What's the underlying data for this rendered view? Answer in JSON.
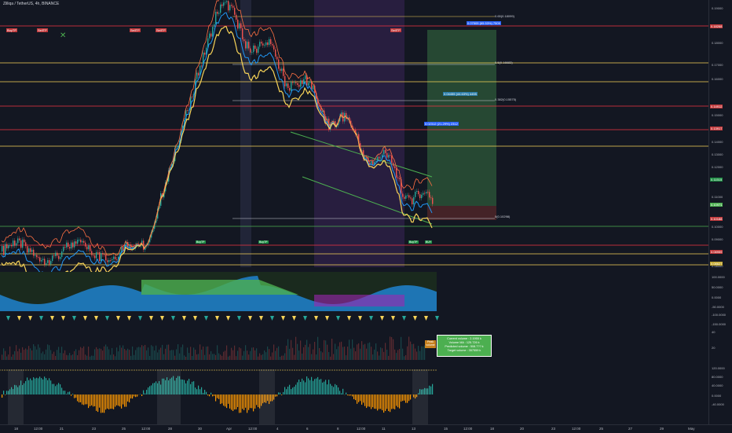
{
  "header": {
    "title": "Zilliqa / TetherUS, 4h, BINANCE"
  },
  "price_axis": {
    "labels": [
      "0.19000",
      "0.18000",
      "0.17000",
      "0.16000",
      "0.15000",
      "0.14000",
      "0.13000",
      "0.12000",
      "0.11000",
      "0.10000",
      "0.09000",
      "0.08000"
    ],
    "tags": [
      {
        "text": "0.18268",
        "color": "#c2393b"
      },
      {
        "text": "0.14912",
        "color": "#c2393b"
      },
      {
        "text": "0.13917",
        "color": "#c2393b"
      },
      {
        "text": "0.11515",
        "color": "#1e8c43"
      },
      {
        "text": "0.10971",
        "color": "#4caf50"
      },
      {
        "text": "0.10188",
        "color": "#c2393b"
      },
      {
        "text": "0.08959",
        "color": "#c2393b"
      },
      {
        "text": "0.08627",
        "color": "#c2a72f"
      }
    ],
    "osc_labels": [
      "100.0000",
      "50.0000",
      "0.0000",
      "-50.0000",
      "-100.0000",
      "-150.0000"
    ],
    "vol_labels": [
      "40",
      "20"
    ],
    "osc2_labels": [
      "120.0000",
      "80.0000",
      "40.0000",
      "0.0000",
      "-40.0000"
    ]
  },
  "fib_labels": [
    {
      "text": "0.65(0.18099)"
    },
    {
      "text": "0.5(0.16683)"
    },
    {
      "text": "0.382(0.15575)"
    },
    {
      "text": "0(0.10298)"
    }
  ],
  "target_boxes": [
    {
      "text": "0.07505 (65.53%) 7509",
      "color": "#2962ff"
    },
    {
      "text": "0.04455 (44.63%) 4455",
      "color": "#2a7ca8"
    },
    {
      "text": "0.02312 (21.29%) 2312",
      "color": "#2962ff"
    }
  ],
  "event_labels": [
    "BuyTP",
    "SellTP",
    "SellTP",
    "SellTP",
    "SellTP",
    "BuyTP",
    "BuyTP",
    "BuyTP",
    "BUY"
  ],
  "volume_box": {
    "lines": [
      "Current volume : 2.1955 k",
      "Volume MA : 125.726 k",
      "Predicted volume : 508.7?? k",
      "Target volume : 357559 k"
    ]
  },
  "note_box": {
    "text": "Peak volume"
  },
  "time_axis": {
    "labels": [
      "18",
      "12:00",
      "21",
      "23",
      "25",
      "12:00",
      "28",
      "30",
      "Apr",
      "12:00",
      "4",
      "6",
      "8",
      "12:00",
      "11",
      "13",
      "15",
      "12:00",
      "18",
      "20",
      "23",
      "12:00",
      "25",
      "27",
      "29",
      "May"
    ]
  },
  "colors": {
    "background": "#131722",
    "up": "#26a69a",
    "down": "#ef5350",
    "support": "#4caf50",
    "resistance": "#f23645",
    "fib": "#f7d358"
  }
}
